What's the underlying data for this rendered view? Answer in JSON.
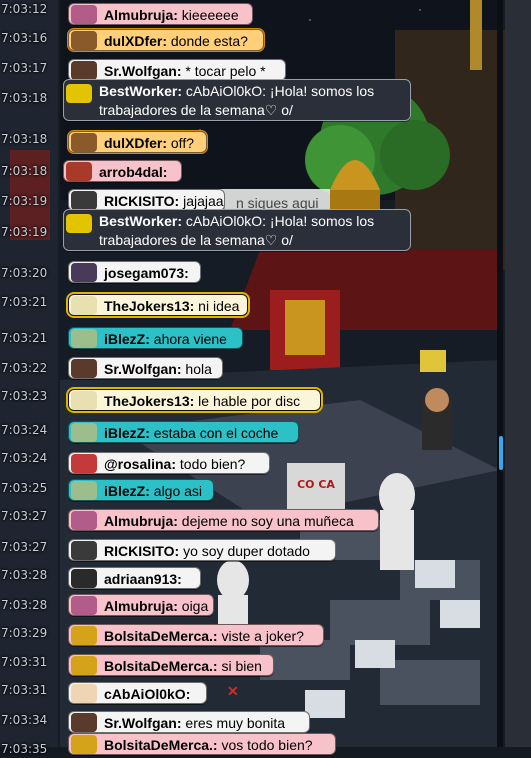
{
  "chat": {
    "messages": [
      {
        "time": "7:03:12",
        "user": "Almubruja:",
        "text": "kieeeeee",
        "style": "pink",
        "avatar": "avatar-almubruja"
      },
      {
        "time": "7:03:16",
        "user": "dulXDfer:",
        "text": "donde esta?",
        "style": "orange",
        "avatar": "avatar-dulxdfer"
      },
      {
        "time": "7:03:17",
        "user": "Sr.Wolfgan:",
        "text": "* tocar pelo *",
        "style": "white",
        "avatar": "avatar-srwolfgan"
      },
      {
        "time": "7:03:18",
        "user": "BestWorker:",
        "text": "cAbAiOl0kO: ¡Hola! somos los trabajadores de la semana♡ o/",
        "style": "dark",
        "avatar": "avatar-bestworker"
      },
      {
        "time": "7:03:18",
        "user": "dulXDfer:",
        "text": "off?",
        "style": "orange",
        "avatar": "avatar-dulxdfer"
      },
      {
        "time": "7:03:18",
        "user": "arrob4dal:",
        "text": "",
        "style": "pink",
        "avatar": "avatar-arrob4dal"
      },
      {
        "time": "7:03:19",
        "user": "RICKISITO:",
        "text": "jajajaa",
        "style": "white",
        "avatar": "avatar-rickisito"
      },
      {
        "time": "7:03:19",
        "user": "BestWorker:",
        "text": "cAbAiOl0kO: ¡Hola! somos los trabajadores de la semana♡ o/",
        "style": "dark",
        "avatar": "avatar-bestworker"
      },
      {
        "time": "7:03:20",
        "user": "josegam073:",
        "text": "",
        "style": "white",
        "avatar": "avatar-josegam073"
      },
      {
        "time": "7:03:21",
        "user": "TheJokers13:",
        "text": "ni idea",
        "style": "gold",
        "avatar": "avatar-thejokers13"
      },
      {
        "time": "7:03:21",
        "user": "iBlezZ:",
        "text": "ahora viene",
        "style": "teal",
        "avatar": "avatar-iblezz"
      },
      {
        "time": "7:03:22",
        "user": "Sr.Wolfgan:",
        "text": "hola",
        "style": "white",
        "avatar": "avatar-srwolfgan"
      },
      {
        "time": "7:03:23",
        "user": "TheJokers13:",
        "text": "le hable por disc",
        "style": "gold",
        "avatar": "avatar-thejokers13"
      },
      {
        "time": "7:03:24",
        "user": "iBlezZ:",
        "text": "estaba con el coche",
        "style": "teal",
        "avatar": "avatar-iblezz"
      },
      {
        "time": "7:03:24",
        "user": "@rosalina:",
        "text": "todo bien?",
        "style": "white",
        "avatar": "avatar-rosalina"
      },
      {
        "time": "7:03:25",
        "user": "iBlezZ:",
        "text": "algo asi",
        "style": "teal",
        "avatar": "avatar-iblezz"
      },
      {
        "time": "7:03:27",
        "user": "Almubruja:",
        "text": "dejeme no soy una muñeca",
        "style": "pink",
        "avatar": "avatar-almubruja"
      },
      {
        "time": "7:03:27",
        "user": "RICKISITO:",
        "text": "yo soy duper dotado",
        "style": "white",
        "avatar": "avatar-rickisito"
      },
      {
        "time": "7:03:28",
        "user": "adriaan913:",
        "text": "",
        "style": "white",
        "avatar": "avatar-adriaan913"
      },
      {
        "time": "7:03:28",
        "user": "Almubruja:",
        "text": "oiga",
        "style": "pink",
        "avatar": "avatar-almubruja"
      },
      {
        "time": "7:03:29",
        "user": "BolsitaDeMerca.:",
        "text": "viste a joker?",
        "style": "pink",
        "avatar": "avatar-bolsitademerca"
      },
      {
        "time": "7:03:31",
        "user": "BolsitaDeMerca.:",
        "text": "si bien",
        "style": "pink",
        "avatar": "avatar-bolsitademerca"
      },
      {
        "time": "7:03:31",
        "user": "cAbAiOl0kO:",
        "text": "",
        "style": "white",
        "avatar": "avatar-cabaiol0ko"
      },
      {
        "time": "7:03:34",
        "user": "Sr.Wolfgan:",
        "text": "eres muy bonita",
        "style": "white",
        "avatar": "avatar-srwolfgan"
      },
      {
        "time": "7:03:35",
        "user": "BolsitaDeMerca.:",
        "text": "vos todo bien?",
        "style": "pink",
        "avatar": "avatar-bolsitademerca"
      }
    ]
  },
  "room": {
    "background_sign_fragment": "n siques aqui",
    "sign_logo": "CO CA"
  },
  "colors": {
    "pink": "#f8c2cb",
    "orange": "#ffcf7a",
    "white": "#f4f4f4",
    "dark": "#2b2f3a",
    "gold": "#e2b400",
    "teal": "#2cc1c7",
    "scroll": "#3ba6e8"
  }
}
